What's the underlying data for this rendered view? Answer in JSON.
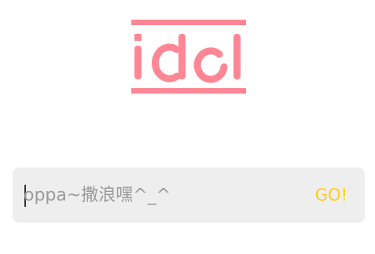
{
  "app": {
    "logo_text": "idol",
    "brand_color": "#ff8795"
  },
  "search": {
    "placeholder": "oppa~撒浪嘿^_^",
    "value": "",
    "go_label": "GO!",
    "go_color": "#ffcc1a",
    "background_color": "#eeeeee"
  }
}
